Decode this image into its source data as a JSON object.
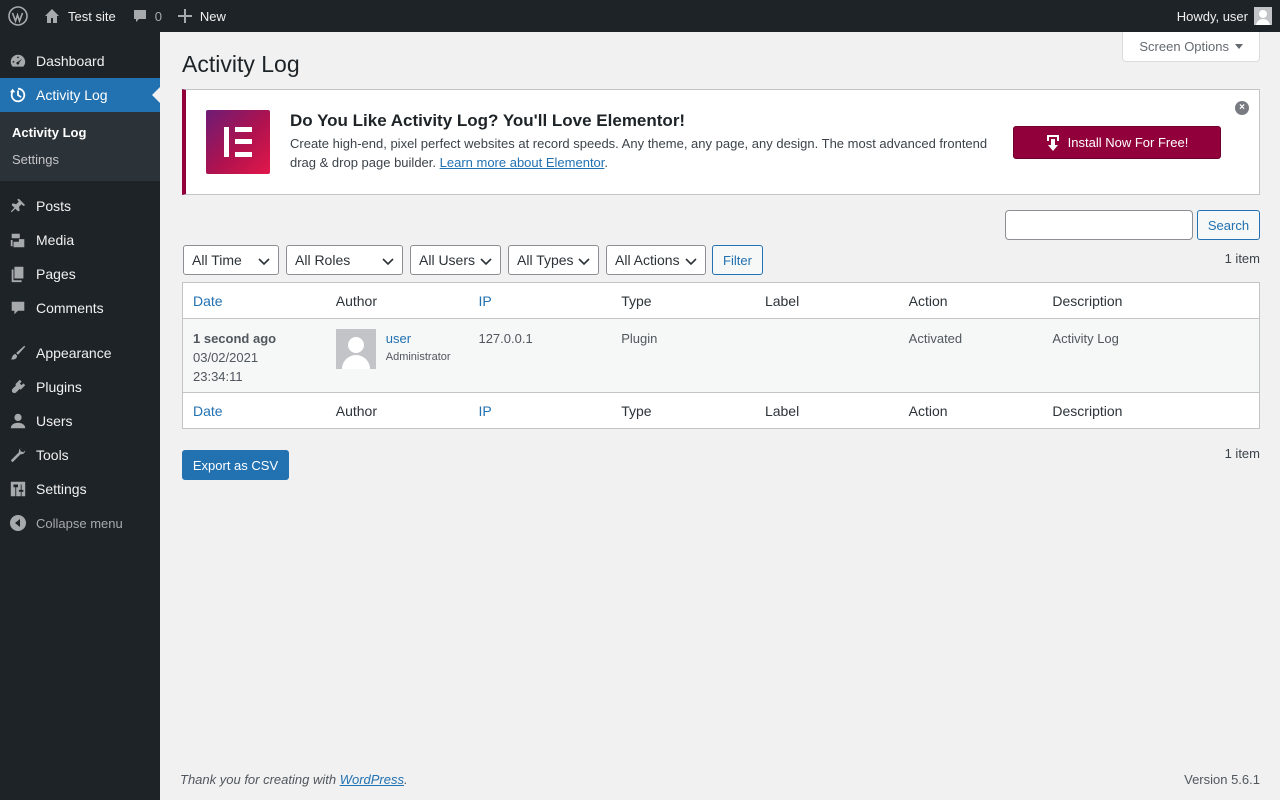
{
  "adminbar": {
    "site_name": "Test site",
    "comments_count": "0",
    "new_label": "New",
    "howdy": "Howdy, user"
  },
  "sidebar": {
    "items": [
      {
        "label": "Dashboard",
        "icon": "dashboard-icon"
      },
      {
        "label": "Activity Log",
        "icon": "history-icon"
      },
      {
        "label": "Posts",
        "icon": "pin-icon"
      },
      {
        "label": "Media",
        "icon": "media-icon"
      },
      {
        "label": "Pages",
        "icon": "pages-icon"
      },
      {
        "label": "Comments",
        "icon": "comment-icon"
      },
      {
        "label": "Appearance",
        "icon": "brush-icon"
      },
      {
        "label": "Plugins",
        "icon": "plugin-icon"
      },
      {
        "label": "Users",
        "icon": "user-icon"
      },
      {
        "label": "Tools",
        "icon": "wrench-icon"
      },
      {
        "label": "Settings",
        "icon": "settings-icon"
      }
    ],
    "submenu": [
      "Activity Log",
      "Settings"
    ],
    "collapse": "Collapse menu"
  },
  "screen_options": "Screen Options",
  "page_title": "Activity Log",
  "notice": {
    "title": "Do You Like Activity Log? You'll Love Elementor!",
    "text": "Create high-end, pixel perfect websites at record speeds. Any theme, any page, any design. The most advanced frontend drag & drop page builder.",
    "link": "Learn more about Elementor",
    "button": "Install Now For Free!",
    "accent_color": "#92003b"
  },
  "search": {
    "value": "",
    "button": "Search"
  },
  "filters": {
    "time": "All Time",
    "roles": "All Roles",
    "users": "All Users",
    "types": "All Types",
    "actions": "All Actions",
    "button": "Filter"
  },
  "item_count": "1 item",
  "table": {
    "columns": [
      "Date",
      "Author",
      "IP",
      "Type",
      "Label",
      "Action",
      "Description"
    ],
    "rows": [
      {
        "date_relative": "1 second ago",
        "date": "03/02/2021",
        "time": "23:34:11",
        "author": "user",
        "role": "Administrator",
        "ip": "127.0.0.1",
        "type": "Plugin",
        "label": "",
        "action": "Activated",
        "description": "Activity Log"
      }
    ]
  },
  "export_button": "Export as CSV",
  "footer": {
    "thanks_prefix": "Thank you for creating with",
    "wordpress_link": "WordPress",
    "version": "Version 5.6.1"
  }
}
